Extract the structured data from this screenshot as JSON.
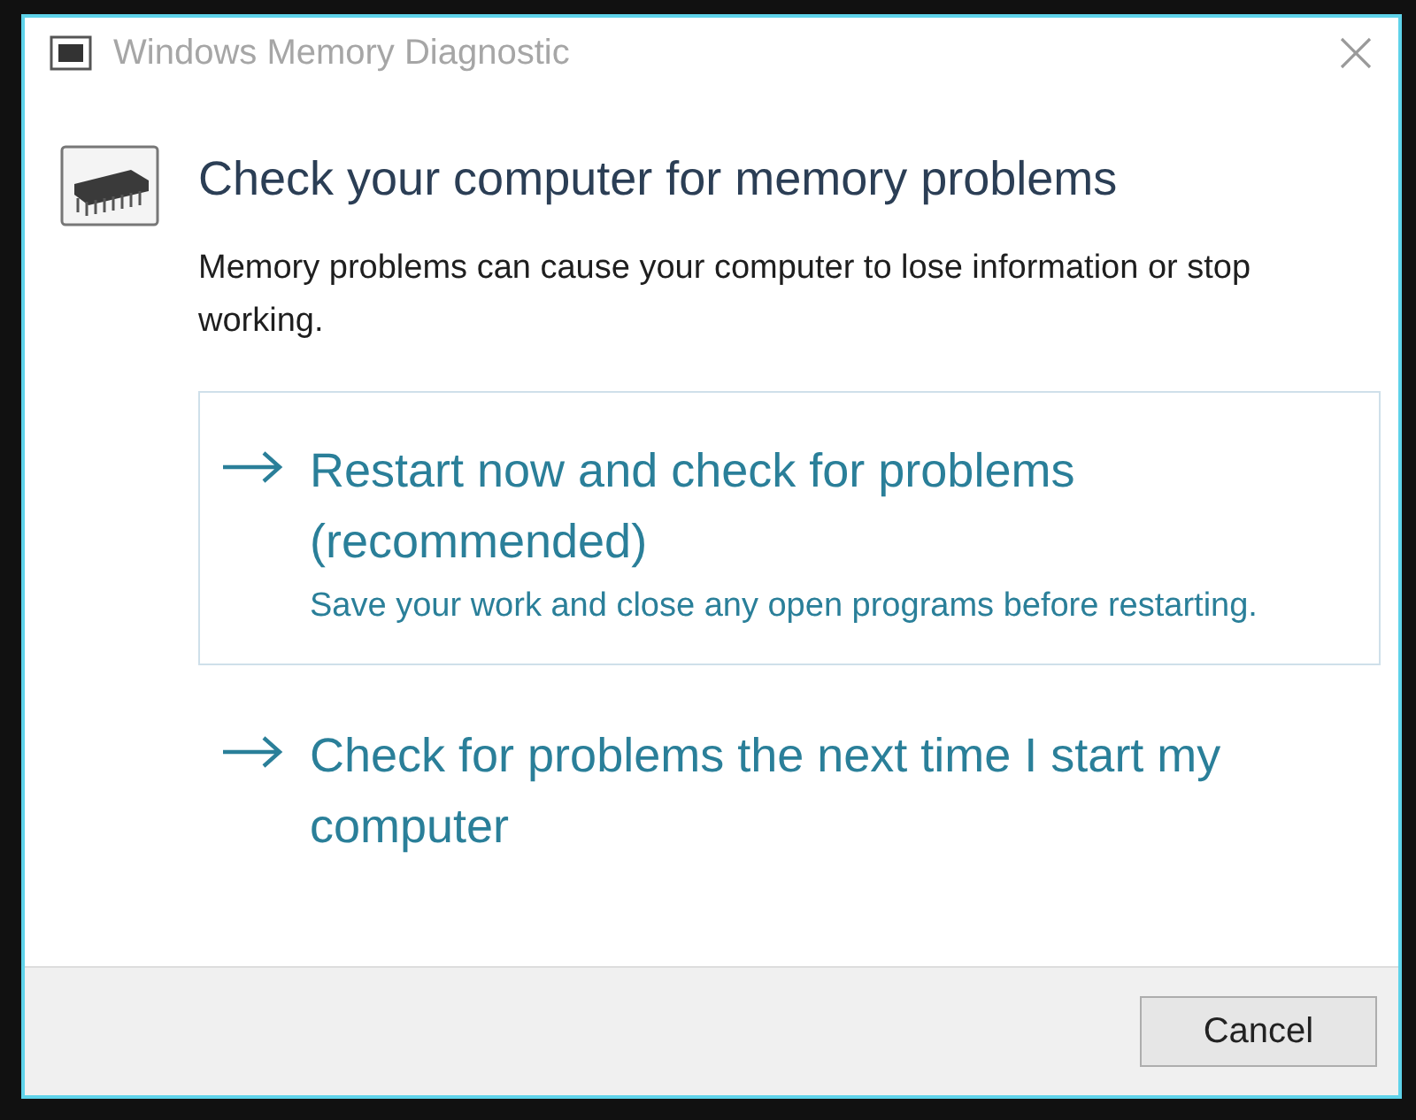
{
  "window": {
    "title": "Windows Memory Diagnostic",
    "active": false
  },
  "heading": "Check your computer for memory problems",
  "description": "Memory problems can cause your computer to lose information or stop working.",
  "options": [
    {
      "label": "Restart now and check for problems (recommended)",
      "note": "Save your work and close any open programs before restarting.",
      "selected": true
    },
    {
      "label": "Check for problems the next time I start my computer",
      "selected": false
    }
  ],
  "buttons": [
    "Cancel"
  ]
}
